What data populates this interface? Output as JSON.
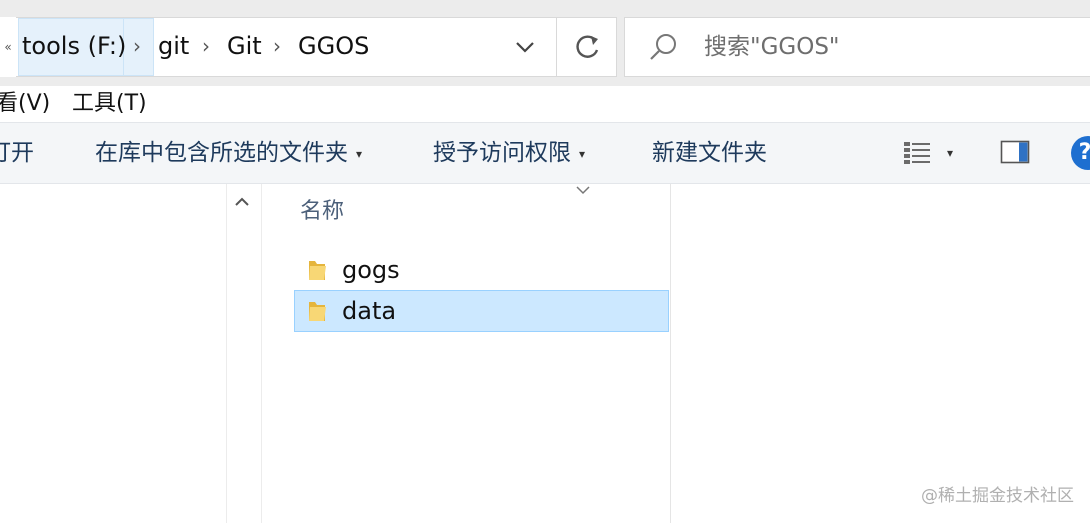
{
  "breadcrumb": {
    "overflow": "«",
    "items": [
      "tools (F:)",
      "git",
      "Git",
      "GGOS"
    ],
    "separator": "›"
  },
  "search": {
    "placeholder": "搜索\"GGOS\""
  },
  "menu": {
    "items": [
      "看(V)",
      "工具(T)"
    ]
  },
  "commands": {
    "open": "打开",
    "include_in_library": "在库中包含所选的文件夹",
    "grant_access": "授予访问权限",
    "new_folder": "新建文件夹",
    "help": "?"
  },
  "file_list": {
    "column_header": "名称",
    "items": [
      {
        "name": "gogs",
        "selected": false
      },
      {
        "name": "data",
        "selected": true
      }
    ]
  },
  "watermark": "@稀土掘金技术社区",
  "colors": {
    "selection": "#cce8ff",
    "selection_border": "#99d1ff",
    "folder": "#f4c95d",
    "help": "#1e6fd0"
  },
  "icons": [
    "chevron-down-icon",
    "refresh-icon",
    "search-icon",
    "view-details-icon",
    "preview-pane-icon",
    "help-icon",
    "scroll-up-icon",
    "sort-arrow-icon",
    "folder-icon"
  ]
}
